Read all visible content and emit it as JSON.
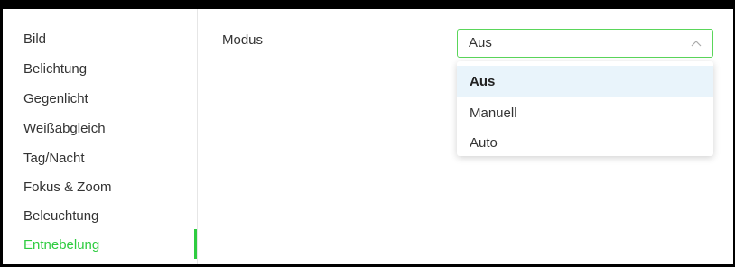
{
  "sidebar": {
    "items": [
      {
        "label": "Bild"
      },
      {
        "label": "Belichtung"
      },
      {
        "label": "Gegenlicht"
      },
      {
        "label": "Weißabgleich"
      },
      {
        "label": "Tag/Nacht"
      },
      {
        "label": "Fokus & Zoom"
      },
      {
        "label": "Beleuchtung"
      },
      {
        "label": "Entnebelung"
      }
    ],
    "active_label": "Entnebelung"
  },
  "main": {
    "modus": {
      "label": "Modus",
      "selected_value": "Aus",
      "options": [
        {
          "label": "Aus"
        },
        {
          "label": "Manuell"
        },
        {
          "label": "Auto"
        }
      ]
    }
  },
  "colors": {
    "accent": "#2ecc40",
    "select_border": "#5ad65a",
    "option_highlight": "#e9f4fb"
  }
}
